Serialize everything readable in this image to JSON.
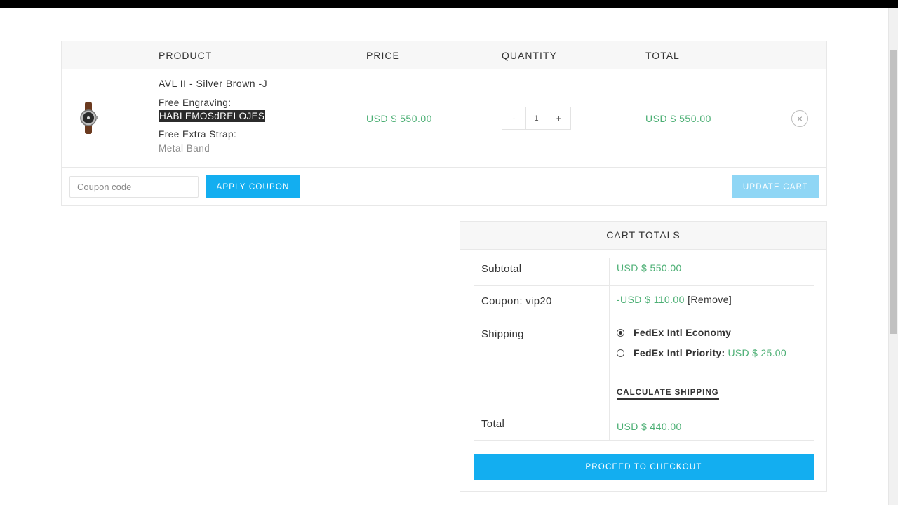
{
  "cart": {
    "headers": {
      "product": "PRODUCT",
      "price": "PRICE",
      "quantity": "QUANTITY",
      "total": "TOTAL"
    },
    "item": {
      "name": "AVL II - Silver Brown -J",
      "engraving_label": "Free Engraving:",
      "engraving_value": "HABLEMOSdRELOJES",
      "strap_label": "Free Extra Strap:",
      "strap_value": "Metal Band",
      "price": "USD $ 550.00",
      "quantity": "1",
      "total": "USD $ 550.00",
      "qty_minus": "-",
      "qty_plus": "+",
      "remove_icon": "×"
    },
    "actions": {
      "coupon_placeholder": "Coupon code",
      "apply_label": "APPLY COUPON",
      "update_label": "UPDATE CART"
    }
  },
  "totals": {
    "title": "CART TOTALS",
    "subtotal_label": "Subtotal",
    "subtotal_value": "USD $ 550.00",
    "coupon_label": "Coupon: vip20",
    "coupon_value": "-USD $ 110.00",
    "coupon_remove": "[Remove]",
    "shipping_label": "Shipping",
    "shipping_options": [
      {
        "label": "FedEx Intl Economy",
        "price": "",
        "selected": true
      },
      {
        "label": "FedEx Intl Priority:",
        "price": "USD $ 25.00",
        "selected": false
      }
    ],
    "calculate_shipping": "CALCULATE SHIPPING",
    "total_label": "Total",
    "total_value": "USD $ 440.00",
    "checkout_label": "PROCEED TO CHECKOUT"
  },
  "colors": {
    "accent": "#13aef0",
    "accent_disabled": "#8fd6f5",
    "price_green": "#4caf74"
  }
}
